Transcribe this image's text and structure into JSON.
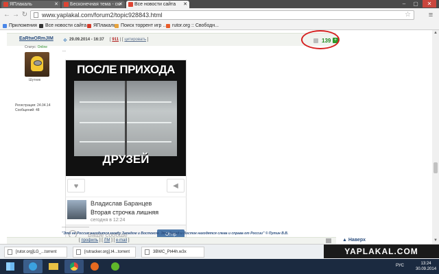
{
  "browser": {
    "tabs": [
      {
        "title": "ЯПлакаль"
      },
      {
        "title": "Бесконечная тема - см"
      },
      {
        "title": "Все новости сайта"
      }
    ],
    "url": "www.yaplakal.com/forum2/topic928843.html",
    "bookmarks": [
      {
        "label": "Приложения",
        "color": "#4a86e8"
      },
      {
        "label": "Все новости сайта",
        "color": "#333333"
      },
      {
        "label": "ЯПлакаль",
        "color": "#d43b2a"
      },
      {
        "label": "Поиск торрент игр ...",
        "color": "#e8a33d"
      },
      {
        "label": "rutor.org :: Свободн...",
        "color": "#e85c2a"
      }
    ]
  },
  "post": {
    "author": "EaRtwORmJIM",
    "meta": {
      "date": "29.09.2014 - 16:37",
      "number": "911",
      "quote_label": "цитировать"
    },
    "rating": "139",
    "user": {
      "status_label": "Статус:",
      "status_value": "Online",
      "rank": "Шутник",
      "registered": "Регистрация: 24.04.14",
      "messages": "Сообщений: 48"
    },
    "dots": "...",
    "meme": {
      "top_text": "ПОСЛЕ ПРИХОДА",
      "bottom_text": "ДРУЗЕЙ"
    },
    "comment": {
      "name": "Владислав Баранцев",
      "text": "Вторая строчка лишняя",
      "time": "сегодня в 12:24",
      "placeholder": "Ваше сообще",
      "send": "Отпр"
    },
    "signature": {
      "line": "--------------------",
      "quote": "\"Это не Россия находится между Западом и Востоком. Это Запад и Восток находятся слева и справа от России\" © Путин В.В."
    },
    "footer": {
      "profile": "профиль",
      "pm": "ЛМ",
      "email": "e-mail"
    },
    "to_top": "Наверх"
  },
  "downloads": [
    {
      "name": "[rutor.org]LG_...torrent"
    },
    {
      "name": "[rutracker.org].t4...torrent"
    },
    {
      "name": "3BWC_Pt44h.w3x"
    }
  ],
  "watermark": "YAPLAKAL.COM",
  "taskbar": {
    "lang": "РУС",
    "time": "13:24",
    "date": "30.09.2014"
  }
}
